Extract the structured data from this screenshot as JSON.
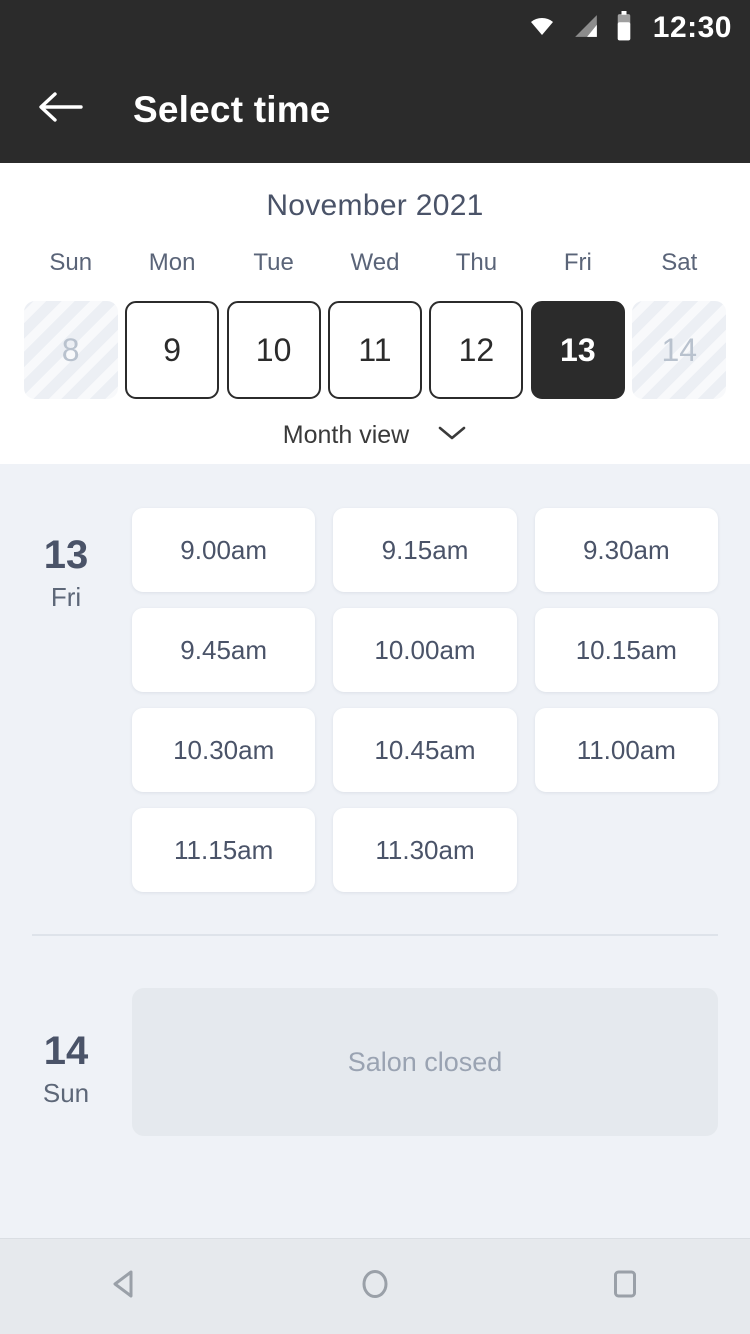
{
  "status_bar": {
    "time": "12:30",
    "icons": [
      "wifi-icon",
      "signal-icon",
      "battery-icon"
    ]
  },
  "app_bar": {
    "back_icon": "arrow-left-icon",
    "title": "Select time"
  },
  "calendar": {
    "month_title": "November 2021",
    "day_headers": [
      "Sun",
      "Mon",
      "Tue",
      "Wed",
      "Thu",
      "Fri",
      "Sat"
    ],
    "dates": [
      {
        "num": "8",
        "state": "disabled"
      },
      {
        "num": "9",
        "state": "available"
      },
      {
        "num": "10",
        "state": "available"
      },
      {
        "num": "11",
        "state": "available"
      },
      {
        "num": "12",
        "state": "available"
      },
      {
        "num": "13",
        "state": "selected"
      },
      {
        "num": "14",
        "state": "disabled"
      }
    ],
    "month_view_label": "Month view",
    "month_view_icon": "chevron-down-icon"
  },
  "schedule": {
    "days": [
      {
        "day_num": "13",
        "day_dow": "Fri",
        "slots": [
          "9.00am",
          "9.15am",
          "9.30am",
          "9.45am",
          "10.00am",
          "10.15am",
          "10.30am",
          "10.45am",
          "11.00am",
          "11.15am",
          "11.30am"
        ]
      },
      {
        "day_num": "14",
        "day_dow": "Sun",
        "closed_label": "Salon closed"
      }
    ]
  },
  "nav_bar": {
    "back_icon": "triangle-back-icon",
    "home_icon": "circle-home-icon",
    "recents_icon": "square-recents-icon"
  },
  "colors": {
    "app_bar_bg": "#2b2b2b",
    "body_bg": "#eff2f7",
    "panel_bg": "#ffffff",
    "accent_text": "#4a5368",
    "muted_text": "#9aa3b2",
    "nav_bar_bg": "#e6e9ed"
  }
}
